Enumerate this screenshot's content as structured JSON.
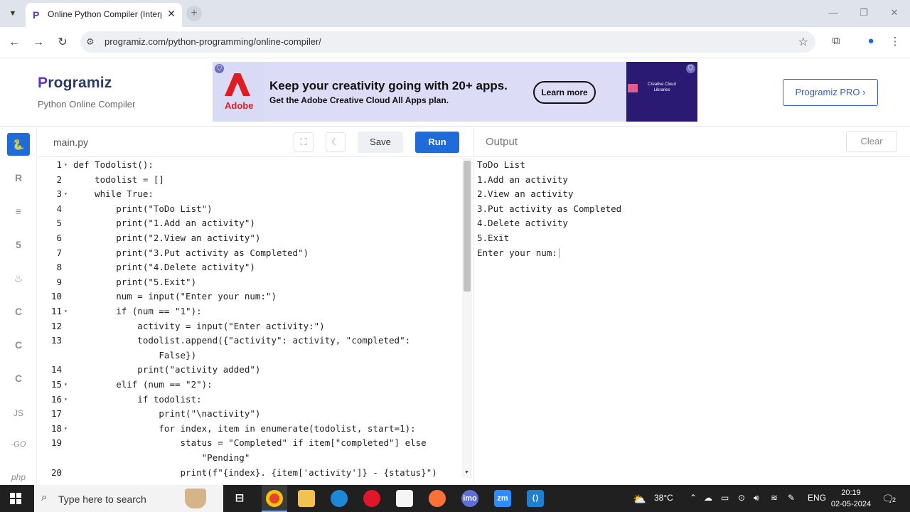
{
  "browser": {
    "tab_title": "Online Python Compiler (Interp",
    "tab_favicon": "P",
    "url": "programiz.com/python-programming/online-compiler/"
  },
  "site": {
    "logo_text": "rogramiz",
    "logo_p": "P",
    "subtitle": "Python Online Compiler",
    "pro_button": "Programiz PRO ›"
  },
  "ad": {
    "brand": "Adobe",
    "headline": "Keep your creativity going with 20+ apps.",
    "subline": "Get the Adobe Creative Cloud All Apps plan.",
    "cta": "Learn more",
    "image_caption": "Creative Cloud Libraries"
  },
  "sidebar": {
    "items": [
      {
        "name": "python",
        "glyph": "🐍"
      },
      {
        "name": "r",
        "glyph": "R"
      },
      {
        "name": "sql",
        "glyph": "≡"
      },
      {
        "name": "html",
        "glyph": "5"
      },
      {
        "name": "java",
        "glyph": "♨"
      },
      {
        "name": "c",
        "glyph": "C"
      },
      {
        "name": "cpp",
        "glyph": "C"
      },
      {
        "name": "csharp",
        "glyph": "C"
      },
      {
        "name": "js",
        "glyph": "JS"
      },
      {
        "name": "go",
        "glyph": "-GO"
      },
      {
        "name": "php",
        "glyph": "php"
      }
    ]
  },
  "editor": {
    "filename": "main.py",
    "save_label": "Save",
    "run_label": "Run",
    "lines": [
      {
        "n": "1",
        "fold": "▾",
        "text": "def Todolist():"
      },
      {
        "n": "2",
        "fold": "",
        "text": "    todolist = []"
      },
      {
        "n": "3",
        "fold": "▾",
        "text": "    while True:"
      },
      {
        "n": "4",
        "fold": "",
        "text": "        print(\"ToDo List\")"
      },
      {
        "n": "5",
        "fold": "",
        "text": "        print(\"1.Add an activity\")"
      },
      {
        "n": "6",
        "fold": "",
        "text": "        print(\"2.View an activity\")"
      },
      {
        "n": "7",
        "fold": "",
        "text": "        print(\"3.Put activity as Completed\")"
      },
      {
        "n": "8",
        "fold": "",
        "text": "        print(\"4.Delete activity\")"
      },
      {
        "n": "9",
        "fold": "",
        "text": "        print(\"5.Exit\")"
      },
      {
        "n": "10",
        "fold": "",
        "text": "        num = input(\"Enter your num:\")"
      },
      {
        "n": "11",
        "fold": "▾",
        "text": "        if (num == \"1\"):"
      },
      {
        "n": "12",
        "fold": "",
        "text": "            activity = input(\"Enter activity:\")"
      },
      {
        "n": "13",
        "fold": "",
        "text": "            todolist.append({\"activity\": activity, \"completed\":"
      },
      {
        "n": "",
        "fold": "",
        "text": "                False})"
      },
      {
        "n": "14",
        "fold": "",
        "text": "            print(\"activity added\")"
      },
      {
        "n": "15",
        "fold": "▾",
        "text": "        elif (num == \"2\"):"
      },
      {
        "n": "16",
        "fold": "▾",
        "text": "            if todolist:"
      },
      {
        "n": "17",
        "fold": "",
        "text": "                print(\"\\nactivity\")"
      },
      {
        "n": "18",
        "fold": "▾",
        "text": "                for index, item in enumerate(todolist, start=1):"
      },
      {
        "n": "19",
        "fold": "",
        "text": "                    status = \"Completed\" if item[\"completed\"] else"
      },
      {
        "n": "",
        "fold": "",
        "text": "                        \"Pending\""
      },
      {
        "n": "20",
        "fold": "",
        "text": "                    print(f\"{index}. {item['activity']} - {status}\")"
      }
    ]
  },
  "output": {
    "title": "Output",
    "clear_label": "Clear",
    "lines": [
      "ToDo List",
      "1.Add an activity",
      "2.View an activity",
      "3.Put activity as Completed",
      "4.Delete activity",
      "5.Exit",
      "Enter your num:"
    ]
  },
  "taskbar": {
    "search_placeholder": "Type here to search",
    "temperature": "38°C",
    "language": "ENG",
    "time": "20:19",
    "date": "02-05-2024",
    "notification_count": "2"
  },
  "colors": {
    "accent": "#1f6bd9",
    "brand_purple": "#5a32d6"
  }
}
